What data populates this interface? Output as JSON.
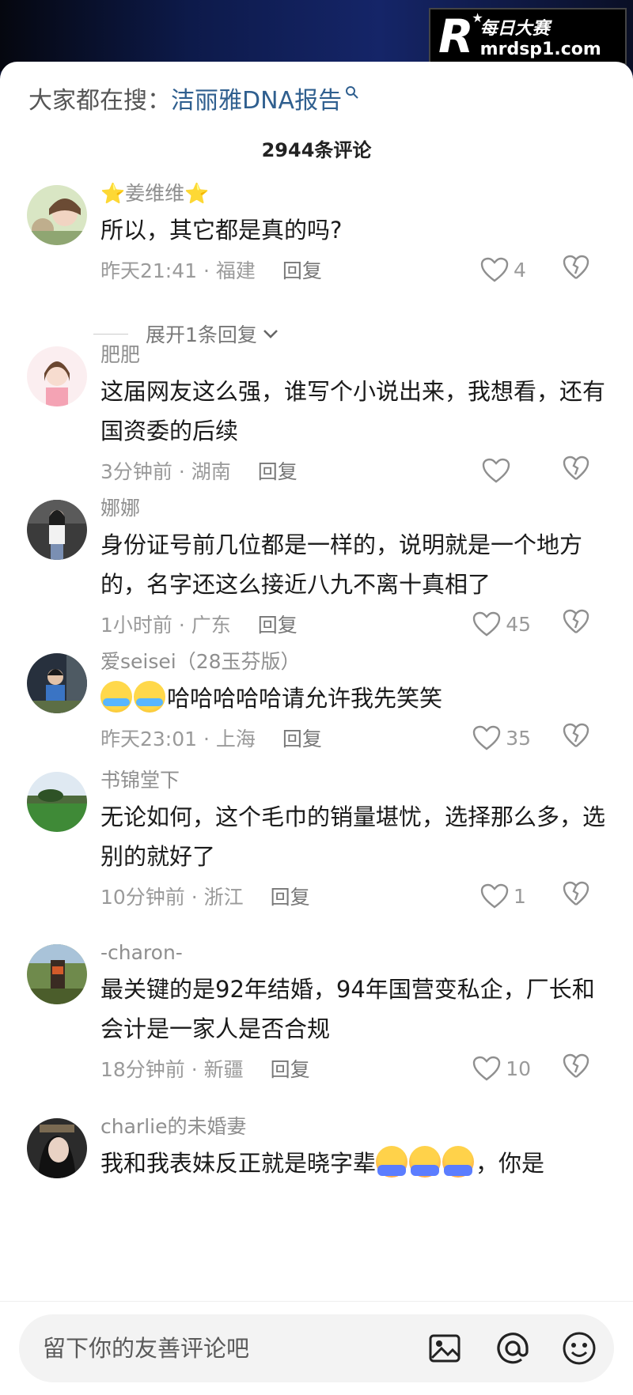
{
  "watermark": {
    "logo": "R",
    "cn": "每日大赛",
    "url": "mrdsp1.com"
  },
  "search": {
    "prefix": "大家都在搜：",
    "term": "洁丽雅DNA报告"
  },
  "comment_count": "2944条评论",
  "comments": [
    {
      "name": "⭐姜维维⭐",
      "text": "所以，其它都是真的吗?",
      "time": "昨天21:41 · 福建",
      "reply": "回复",
      "likes": "4"
    },
    {
      "name": "肥肥",
      "text": "这届网友这么强，谁写个小说出来，我想看，还有国资委的后续",
      "time": "3分钟前 · 湖南",
      "reply": "回复",
      "likes": ""
    },
    {
      "name": "娜娜",
      "text": "身份证号前几位都是一样的，说明就是一个地方的，名字还这么接近八九不离十真相了",
      "time": "1小时前 · 广东",
      "reply": "回复",
      "likes": "45"
    },
    {
      "name": "爱seisei（28玉芬版）",
      "text": "哈哈哈哈哈请允许我先笑笑",
      "time": "昨天23:01 · 上海",
      "reply": "回复",
      "likes": "35"
    },
    {
      "name": "书锦堂下",
      "text": "无论如何，这个毛巾的销量堪忧，选择那么多，选别的就好了",
      "time": "10分钟前 · 浙江",
      "reply": "回复",
      "likes": "1"
    },
    {
      "name": "-charon-",
      "text": "最关键的是92年结婚，94年国营变私企，厂长和会计是一家人是否合规",
      "time": "18分钟前 · 新疆",
      "reply": "回复",
      "likes": "10"
    },
    {
      "name": "charlie的未婚妻",
      "text": "我和我表妹反正就是晓字辈",
      "text_after": "，你是"
    }
  ],
  "expand_replies": "展开1条回复",
  "input_placeholder": "留下你的友善评论吧",
  "icons": [
    "search-icon",
    "heart-icon",
    "dislike-icon",
    "chevron-down-icon",
    "image-icon",
    "at-icon",
    "emoji-icon"
  ],
  "colors": {
    "search_term": "#2f5f8f",
    "meta": "#9a9a9a",
    "text": "#1a1a1a"
  }
}
